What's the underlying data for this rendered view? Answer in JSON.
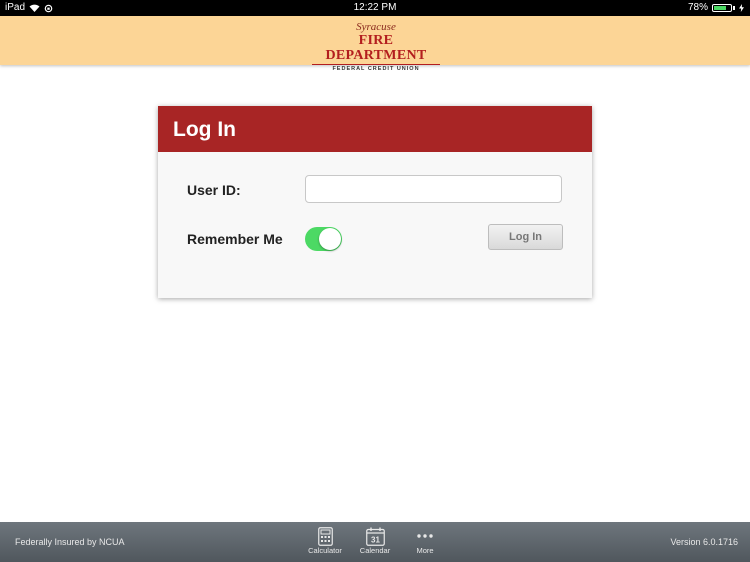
{
  "status_bar": {
    "device": "iPad",
    "time": "12:22 PM",
    "battery": "78%",
    "battery_level": 0.78
  },
  "header": {
    "logo_top": "Syracuse",
    "logo_main": "FIRE DEPARTMENT",
    "logo_sub": "FEDERAL CREDIT UNION"
  },
  "login": {
    "title": "Log In",
    "user_id_label": "User ID:",
    "user_id_value": "",
    "remember_label": "Remember Me",
    "remember_on": true,
    "button_label": "Log In"
  },
  "footer": {
    "insured": "Federally Insured by NCUA",
    "calculator": "Calculator",
    "calendar": "Calendar",
    "calendar_day": "31",
    "more": "More",
    "version": "Version 6.0.1716"
  },
  "colors": {
    "header_bg": "#fcd596",
    "card_header": "#a82525",
    "toggle_on": "#4cd964",
    "footer_bg": "#5d646a"
  }
}
